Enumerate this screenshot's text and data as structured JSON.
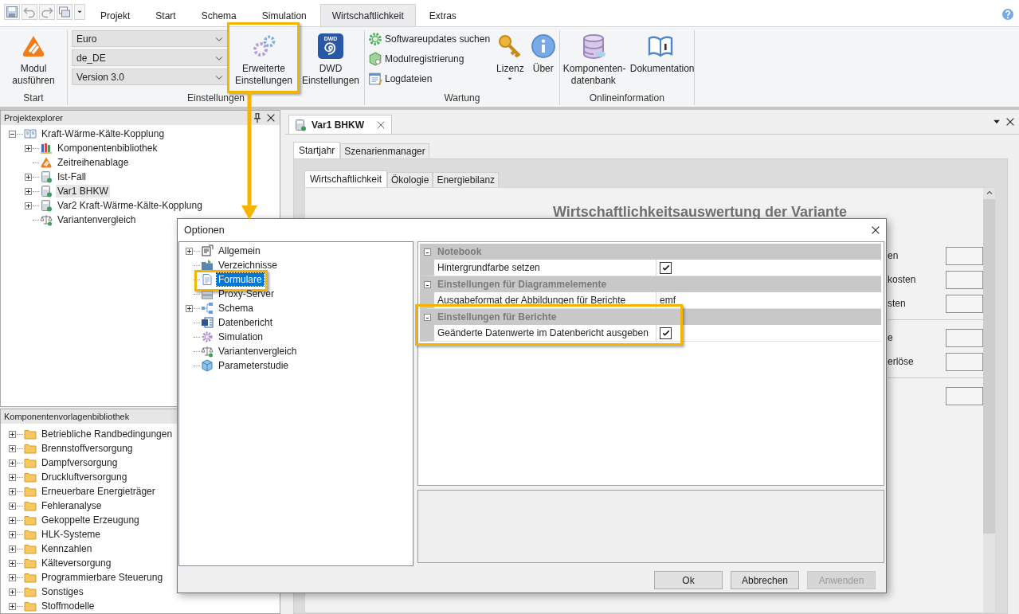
{
  "ribbon_tabs": [
    {
      "label": "Projekt",
      "selected": false
    },
    {
      "label": "Start",
      "selected": false
    },
    {
      "label": "Schema",
      "selected": false
    },
    {
      "label": "Simulation",
      "selected": false
    },
    {
      "label": "Wirtschaftlichkeit",
      "selected": true
    },
    {
      "label": "Extras",
      "selected": false
    }
  ],
  "ribbon_groups": [
    {
      "label": "Start",
      "items": [
        {
          "kind": "large",
          "label": "Modul ausführen",
          "highlighted": false
        }
      ]
    },
    {
      "label": "Einstellungen",
      "items": [
        {
          "kind": "dropdown",
          "value": "Euro"
        },
        {
          "kind": "dropdown",
          "value": "de_DE"
        },
        {
          "kind": "dropdown",
          "value": "Version 3.0"
        },
        {
          "kind": "large",
          "label": "Erweiterte Einstellungen",
          "highlighted": true
        },
        {
          "kind": "logo",
          "label": "DWD Einstellungen",
          "logo_text": "DWD",
          "highlighted": false
        }
      ]
    },
    {
      "label": "Wartung",
      "items": [
        {
          "kind": "small",
          "label": "Softwareupdates suchen"
        },
        {
          "kind": "small",
          "label": "Modulregistrierung"
        },
        {
          "kind": "small",
          "label": "Logdateien"
        },
        {
          "kind": "menu",
          "label": "Lizenz",
          "highlighted": false
        },
        {
          "kind": "large",
          "label": "Über",
          "highlighted": false
        }
      ]
    },
    {
      "label": "Onlineinformation",
      "items": [
        {
          "kind": "large",
          "label": "Komponenten-datenbank",
          "highlighted": false
        },
        {
          "kind": "large",
          "label": "Dokumentation",
          "highlighted": false
        }
      ]
    }
  ],
  "project_explorer": {
    "title": "Projektexplorer",
    "tree": [
      {
        "label": "Kraft-Wärme-Kälte-Kopplung",
        "expandable": true,
        "expanded": true,
        "selected": false,
        "children": [
          {
            "label": "Komponentenbibliothek",
            "expandable": true,
            "expanded": false,
            "selected": false
          },
          {
            "label": "Zeitreihenablage",
            "expandable": false,
            "expanded": false,
            "selected": false
          },
          {
            "label": "Ist-Fall",
            "expandable": true,
            "expanded": false,
            "selected": false
          },
          {
            "label": "Var1 BHKW",
            "expandable": true,
            "expanded": false,
            "selected": true
          },
          {
            "label": "Var2 Kraft-Wärme-Kälte-Kopplung",
            "expandable": true,
            "expanded": false,
            "selected": false
          },
          {
            "label": "Variantenvergleich",
            "expandable": false,
            "expanded": false,
            "selected": false
          }
        ]
      }
    ]
  },
  "template_library": {
    "title": "Komponentenvorlagenbibliothek",
    "items": [
      {
        "label": "Betriebliche Randbedingungen",
        "expanded": false
      },
      {
        "label": "Brennstoffversorgung",
        "expanded": false
      },
      {
        "label": "Dampfversorgung",
        "expanded": false
      },
      {
        "label": "Druckluftversorgung",
        "expanded": false
      },
      {
        "label": "Erneuerbare Energieträger",
        "expanded": false
      },
      {
        "label": "Fehleranalyse",
        "expanded": false
      },
      {
        "label": "Gekoppelte Erzeugung",
        "expanded": false
      },
      {
        "label": "HLK-Systeme",
        "expanded": false
      },
      {
        "label": "Kennzahlen",
        "expanded": false
      },
      {
        "label": "Kälteversorgung",
        "expanded": false
      },
      {
        "label": "Programmierbare Steuerung",
        "expanded": false
      },
      {
        "label": "Sonstiges",
        "expanded": false
      },
      {
        "label": "Stoffmodelle",
        "expanded": false
      }
    ]
  },
  "document": {
    "tab": "Var1 BHKW",
    "subtabs": [
      {
        "label": "Startjahr",
        "selected": true
      },
      {
        "label": "Szenarienmanager",
        "selected": false
      }
    ],
    "pages": [
      {
        "label": "Wirtschaftlichkeit",
        "selected": true
      },
      {
        "label": "Ökologie",
        "selected": false
      },
      {
        "label": "Energiebilanz",
        "selected": false
      }
    ],
    "heading": "Wirtschaftlichkeitsauswertung der Variante",
    "form_sections": [
      {
        "rows": [
          {
            "kind": "labeled",
            "label": "en"
          },
          {
            "kind": "labeled",
            "label": "kosten"
          },
          {
            "kind": "labeled",
            "label": "sten"
          }
        ]
      },
      {
        "rows": [
          {
            "kind": "labeled",
            "label": "e"
          },
          {
            "kind": "labeled",
            "label": "erlöse"
          }
        ]
      },
      {
        "rows": [
          {
            "kind": "field"
          }
        ]
      }
    ]
  },
  "dialog": {
    "title": "Optionen",
    "tree": [
      {
        "label": "Allgemein",
        "expandable": true,
        "selected": false,
        "highlighted": false
      },
      {
        "label": "Verzeichnisse",
        "expandable": false,
        "selected": false,
        "highlighted": false
      },
      {
        "label": "Formulare",
        "expandable": false,
        "selected": true,
        "highlighted": true
      },
      {
        "label": "Proxy-Server",
        "expandable": false,
        "selected": false,
        "highlighted": false
      },
      {
        "label": "Schema",
        "expandable": true,
        "selected": false,
        "highlighted": false
      },
      {
        "label": "Datenbericht",
        "expandable": false,
        "selected": false,
        "highlighted": false
      },
      {
        "label": "Simulation",
        "expandable": false,
        "selected": false,
        "highlighted": false
      },
      {
        "label": "Variantenvergleich",
        "expandable": false,
        "selected": false,
        "highlighted": false
      },
      {
        "label": "Parameterstudie",
        "expandable": false,
        "selected": false,
        "highlighted": false
      }
    ],
    "grid": [
      {
        "category": "Notebook",
        "expanded": true,
        "highlighted": false,
        "rows": [
          {
            "name": "Hintergrundfarbe setzen",
            "kind": "checkbox",
            "checked": true
          }
        ]
      },
      {
        "category": "Einstellungen für Diagrammelemente",
        "expanded": true,
        "highlighted": false,
        "rows": [
          {
            "name": "Ausgabeformat der Abbildungen für Berichte",
            "kind": "text",
            "value": "emf"
          }
        ]
      },
      {
        "category": "Einstellungen für Berichte",
        "expanded": true,
        "highlighted": true,
        "rows": [
          {
            "name": "Geänderte Datenwerte im Datenbericht ausgeben",
            "kind": "checkbox",
            "checked": true
          }
        ]
      }
    ],
    "buttons": [
      {
        "label": "Ok",
        "disabled": false
      },
      {
        "label": "Abbrechen",
        "disabled": false
      },
      {
        "label": "Anwenden",
        "disabled": true
      }
    ]
  }
}
